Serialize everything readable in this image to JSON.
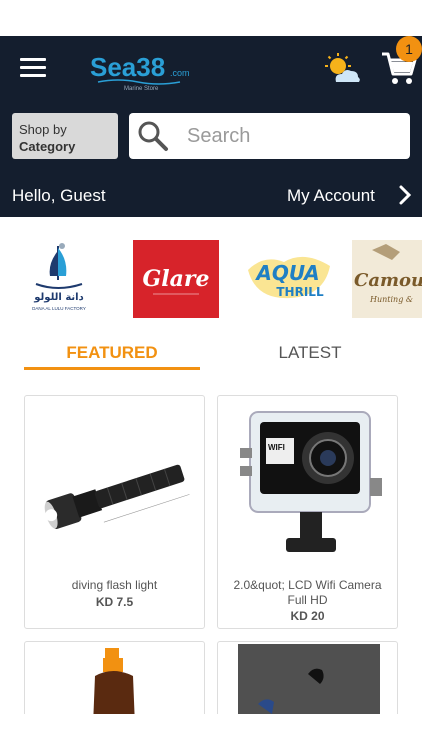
{
  "header": {
    "logo_text": "Sea38",
    "logo_domain": ".com",
    "logo_tagline": "Marine Store",
    "cart_count": "1",
    "shop_by_line1": "Shop by",
    "shop_by_line2": "Category",
    "search_placeholder": "Search",
    "greeting": "Hello, Guest",
    "account_label": "My Account"
  },
  "brands": [
    {
      "name": "Dana Al Lulu Factory",
      "text_ar": "دانة اللولو",
      "text_en": "DANA AL LULU FACTORY"
    },
    {
      "name": "Glare",
      "text": "Glare"
    },
    {
      "name": "Aqua Thrill",
      "text1": "AQUA",
      "text2": "THRILL"
    },
    {
      "name": "Camou",
      "text": "Camou",
      "sub": "Hunting &"
    }
  ],
  "tabs": {
    "featured": "FEATURED",
    "latest": "LATEST"
  },
  "products": [
    {
      "name": "diving flash light",
      "price": "KD 7.5"
    },
    {
      "name": "2.0&quot; LCD Wifi  Camera Full HD",
      "price": "KD 20"
    }
  ],
  "colors": {
    "header_bg": "#141e2e",
    "accent": "#f29111",
    "logo_blue": "#2a9fd6"
  }
}
